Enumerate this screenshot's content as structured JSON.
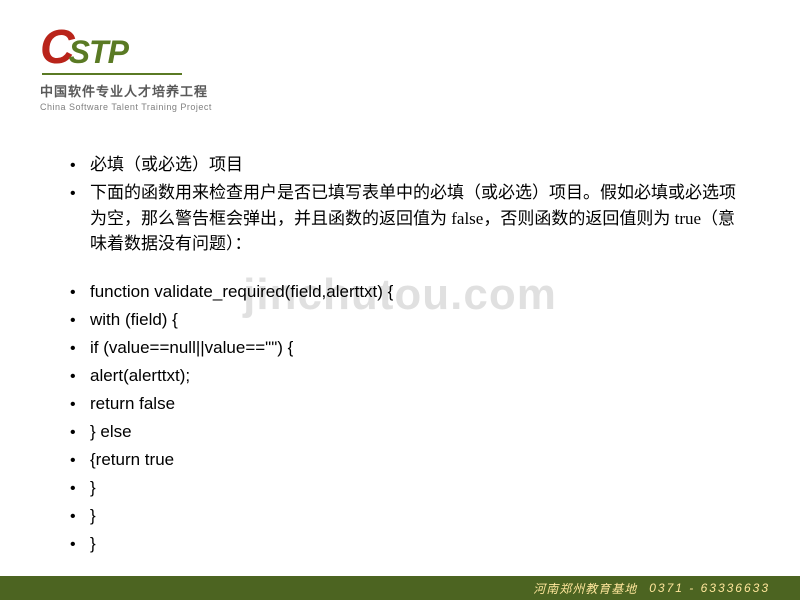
{
  "logo": {
    "c": "C",
    "stp": "STP",
    "cn": "中国软件专业人才培养工程",
    "en": "China Software Talent Training Project"
  },
  "bullets": [
    "必填（或必选）项目",
    "下面的函数用来检查用户是否已填写表单中的必填（或必选）项目。假如必填或必选项为空，那么警告框会弹出，并且函数的返回值为 false，否则函数的返回值则为 true（意味着数据没有问题）："
  ],
  "code": [
    "function validate_required(field,alerttxt) {",
    "with (field) {",
    " if (value==null||value==\"\") {",
    "alert(alerttxt);",
    "return false",
    "} else",
    "{return true",
    "   }",
    "  }",
    " }"
  ],
  "watermark": "jinchutou.com",
  "footer": {
    "location": "河南郑州教育基地",
    "phone": "0371 - 63336633"
  }
}
